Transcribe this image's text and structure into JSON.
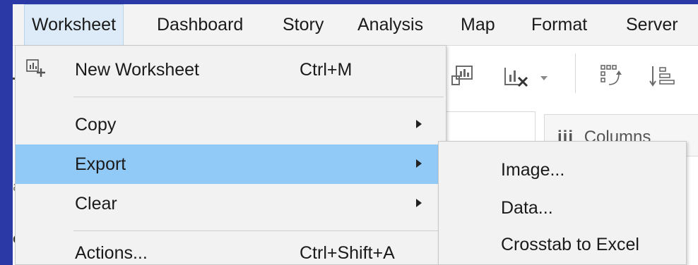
{
  "menubar": {
    "items": [
      {
        "label": "Worksheet",
        "active": true
      },
      {
        "label": "Dashboard"
      },
      {
        "label": "Story"
      },
      {
        "label": "Analysis"
      },
      {
        "label": "Map"
      },
      {
        "label": "Format"
      },
      {
        "label": "Server"
      }
    ]
  },
  "worksheet_menu": {
    "items": [
      {
        "label": "New Worksheet",
        "shortcut": "Ctrl+M",
        "icon": "new-worksheet-icon"
      },
      {
        "label": "Copy",
        "has_submenu": true
      },
      {
        "label": "Export",
        "has_submenu": true,
        "highlighted": true
      },
      {
        "label": "Clear",
        "has_submenu": true
      },
      {
        "label": "Actions...",
        "shortcut": "Ctrl+Shift+A"
      }
    ]
  },
  "export_submenu": {
    "items": [
      {
        "label": "Image..."
      },
      {
        "label": "Data..."
      },
      {
        "label": "Crosstab to Excel"
      }
    ]
  },
  "background": {
    "columns_shelf_label": "Columns",
    "columns_icon": "iii",
    "edge_glyphs": [
      "a",
      "c"
    ]
  },
  "colors": {
    "frame": "#2a39a5",
    "highlight": "#91c9f7",
    "menu_bg": "#f2f2f2",
    "active_tab": "#dcebf7"
  }
}
